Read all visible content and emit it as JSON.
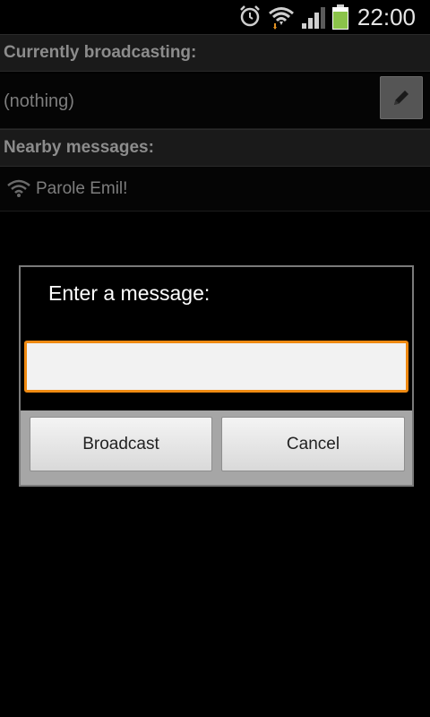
{
  "status_bar": {
    "time": "22:00",
    "icons": [
      "alarm-icon",
      "wifi-icon",
      "signal-icon",
      "battery-icon"
    ],
    "battery_color": "#8bc34a"
  },
  "sections": {
    "broadcasting_header": "Currently broadcasting:",
    "broadcasting_value": "(nothing)",
    "nearby_header": "Nearby messages:",
    "nearby_items": [
      {
        "icon": "wifi-icon",
        "text": "Parole Emil!"
      }
    ]
  },
  "dialog": {
    "title": "Enter a message:",
    "input_value": "",
    "input_placeholder": "",
    "accent_color": "#ef8a12",
    "buttons": {
      "broadcast": "Broadcast",
      "cancel": "Cancel"
    }
  }
}
